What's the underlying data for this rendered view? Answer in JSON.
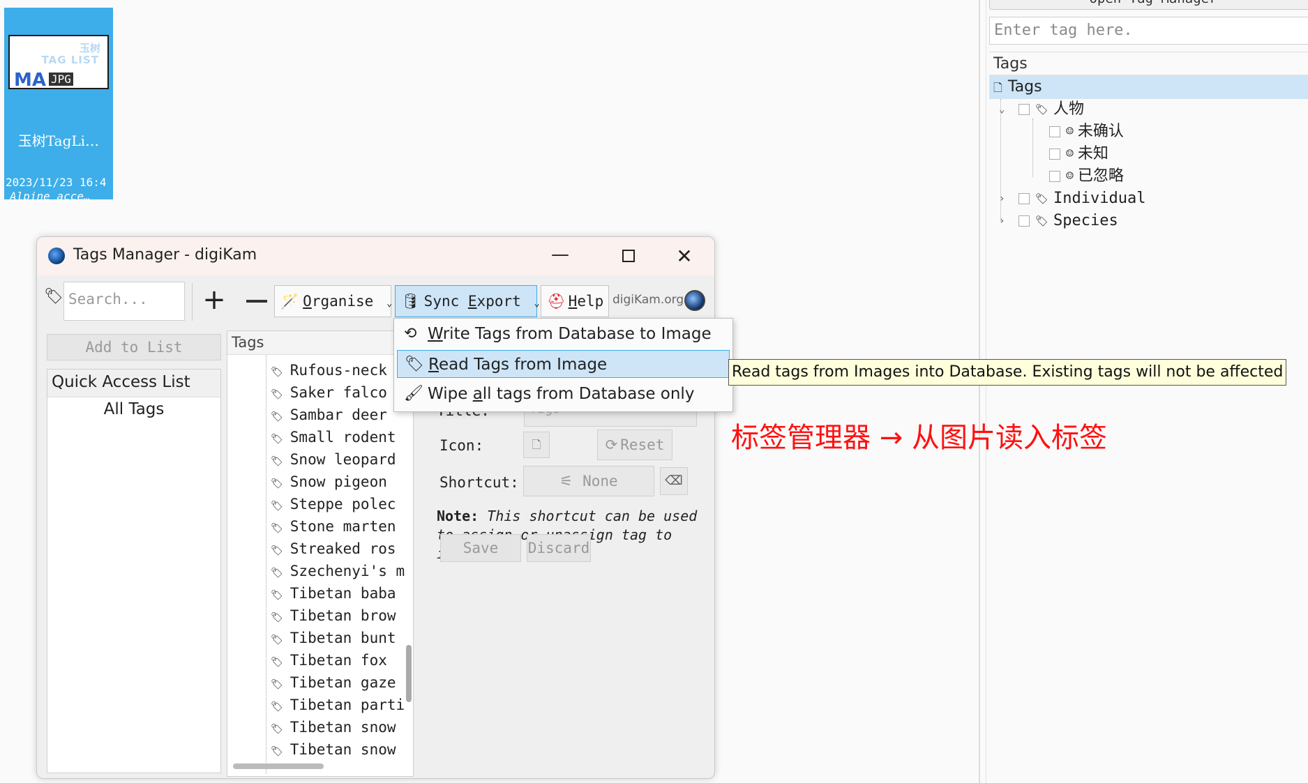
{
  "thumbnail": {
    "image_text_1": "玉树",
    "image_text_2": "TAG LIST",
    "image_text_3": "MA",
    "image_badge": "JPG",
    "name": "玉树TagLi…",
    "date": "2023/11/23 16:4",
    "description": "Alpine acce…"
  },
  "right_panel": {
    "open_button": "Open Tag Manager",
    "entry_placeholder": "Enter tag here.",
    "header": "Tags",
    "root_label": "Tags",
    "tree": [
      {
        "label": "人物",
        "expanded": true
      },
      {
        "label": "未确认"
      },
      {
        "label": "未知"
      },
      {
        "label": "已忽略"
      },
      {
        "label": "Individual",
        "expanded": false
      },
      {
        "label": "Species",
        "expanded": false
      }
    ]
  },
  "window": {
    "title": "Tags Manager - digiKam",
    "search_placeholder": "Search...",
    "toolbar": {
      "organise_pre": "",
      "organise_u": "O",
      "organise_post": "rganise",
      "sync_pre": "Sync ",
      "sync_u": "E",
      "sync_post": "xport",
      "help_u": "H",
      "help_post": "elp",
      "website": "digiKam.org"
    },
    "add_to_list": "Add to List",
    "quick_access_header": "Quick Access List",
    "quick_access_items": [
      "All Tags"
    ],
    "tags_list_header": "Tags",
    "tags_list": [
      "Rufous-neck",
      "Saker falco",
      "Sambar deer",
      "Small rodent",
      "Snow leopard",
      "Snow pigeon",
      "Steppe polec",
      "Stone marten",
      "Streaked ros",
      "Szechenyi's m",
      "Tibetan baba",
      "Tibetan brow",
      "Tibetan bunt",
      "Tibetan fox",
      "Tibetan gaze",
      "Tibetan parti",
      "Tibetan snow",
      "Tibetan snow"
    ],
    "properties": {
      "title_label": "Title:",
      "title_value": "Tags",
      "icon_label": "Icon:",
      "reset_label": "Reset",
      "shortcut_label": "Shortcut:",
      "shortcut_value": "None",
      "note_bold": "Note:",
      "note_text": "This shortcut can be used to assign or unassign tag to items..",
      "save": "Save",
      "discard": "Discard"
    },
    "sync_menu": [
      {
        "pre": "",
        "u": "W",
        "post": "rite Tags from Database to Image"
      },
      {
        "pre": "",
        "u": "R",
        "post": "ead Tags from Image"
      },
      {
        "pre": "Wipe ",
        "u": "a",
        "post": "ll tags from Database only"
      }
    ]
  },
  "tooltip": "Read tags from Images into Database. Existing tags will not be affected",
  "annotation": "标签管理器 → 从图片读入标签",
  "colors": {
    "accent": "#3daee9",
    "selection": "#cde5f7",
    "annotation": "#ff1111",
    "tooltip_bg": "#ffffdc"
  }
}
